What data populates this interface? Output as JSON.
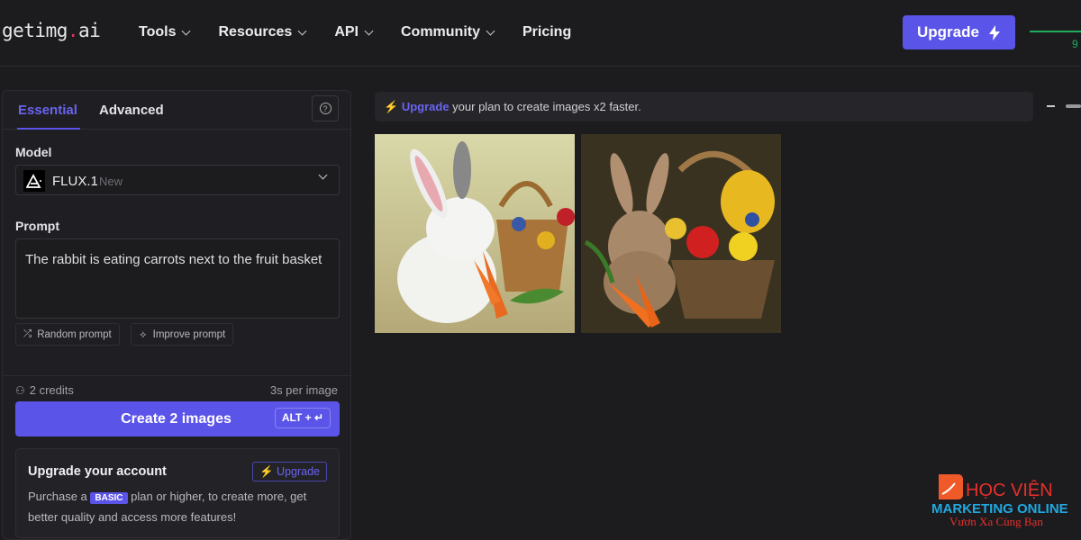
{
  "header": {
    "logo_main": "getimg",
    "logo_dot": ".",
    "logo_tld": "ai",
    "nav": [
      {
        "label": "Tools",
        "dropdown": true
      },
      {
        "label": "Resources",
        "dropdown": true
      },
      {
        "label": "API",
        "dropdown": true
      },
      {
        "label": "Community",
        "dropdown": true
      },
      {
        "label": "Pricing",
        "dropdown": false
      }
    ],
    "upgrade_label": "Upgrade",
    "credit_partial": "9"
  },
  "panel": {
    "tabs": [
      {
        "label": "Essential",
        "active": true
      },
      {
        "label": "Advanced",
        "active": false
      }
    ],
    "model_label": "Model",
    "model_name": "FLUX.1",
    "model_badge": "New",
    "prompt_label": "Prompt",
    "prompt_value": "The rabbit is eating carrots next to the fruit basket",
    "random_prompt": "Random prompt",
    "improve_prompt": "Improve prompt",
    "credits": "2 credits",
    "time_per_image": "3s per image",
    "create_label": "Create 2 images",
    "shortcut": "ALT +",
    "card": {
      "title": "Upgrade your account",
      "button": "Upgrade",
      "text_before": "Purchase a",
      "badge": "BASIC",
      "text_after": "plan or higher, to create more, get better quality and access more features!"
    }
  },
  "main": {
    "banner_link": "Upgrade",
    "banner_text": "your plan to create images x2 faster."
  },
  "watermark": {
    "line1": "HỌC VIỆN",
    "line2": "MARKETING ONLINE",
    "line3": "Vươn Xa Cùng Bạn"
  },
  "colors": {
    "accent": "#5b54e8",
    "background": "#1c1c1f",
    "green": "#1fae5c"
  }
}
